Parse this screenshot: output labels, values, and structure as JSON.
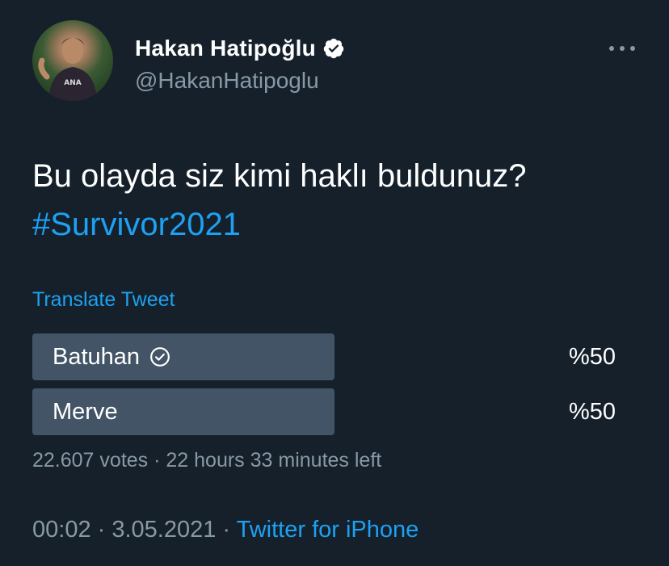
{
  "author": {
    "display_name": "Hakan Hatipoğlu",
    "handle": "@HakanHatipoglu",
    "verified": true
  },
  "tweet": {
    "text": "Bu olayda siz kimi haklı buldunuz?",
    "hashtag": "#Survivor2021",
    "translate_label": "Translate Tweet"
  },
  "poll": {
    "options": [
      {
        "label": "Batuhan",
        "percent_text": "%50",
        "share": 0.5,
        "selected": true
      },
      {
        "label": "Merve",
        "percent_text": "%50",
        "share": 0.5,
        "selected": false
      }
    ],
    "votes": "22.607 votes",
    "separator": " · ",
    "time_left": "22 hours 33 minutes left"
  },
  "footer": {
    "time": "00:02",
    "separator": " · ",
    "date": "3.05.2021",
    "source": "Twitter for iPhone"
  },
  "colors": {
    "background": "#15202b",
    "accent": "#1da1f2",
    "muted": "#8899a6",
    "poll_bar": "#425466"
  },
  "icons": {
    "verified": "verified-badge-icon",
    "selected": "check-circle-icon",
    "more": "more-horizontal-icon"
  }
}
